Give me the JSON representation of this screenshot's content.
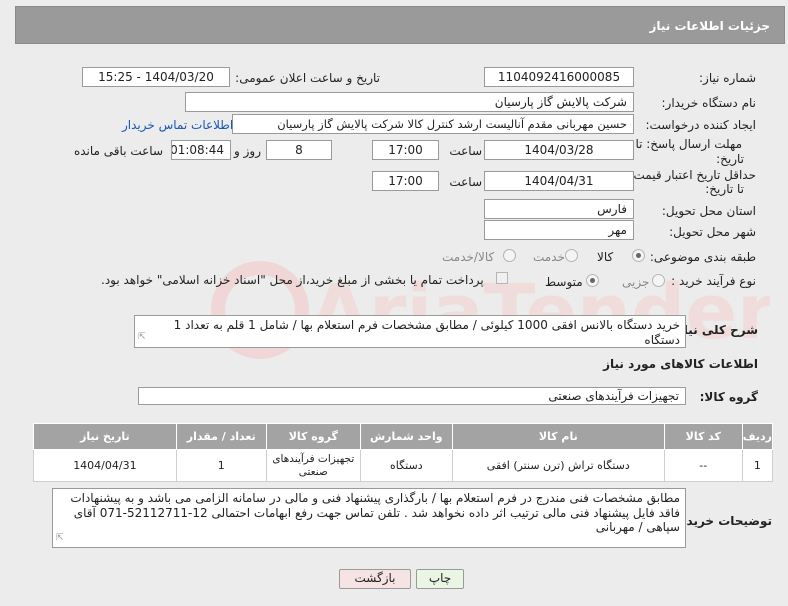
{
  "header": {
    "title": "جزئیات اطلاعات نیاز"
  },
  "fields": {
    "need_number_label": "شماره نیاز:",
    "need_number": "1104092416000085",
    "announce_label": "تاریخ و ساعت اعلان عمومی:",
    "announce_value": "1404/03/20 - 15:25",
    "buyer_org_label": "نام دستگاه خریدار:",
    "buyer_org": "شرکت پالایش گاز پارسیان",
    "requester_label": "ایجاد کننده درخواست:",
    "requester": "حسین مهربانی مقدم آنالیست ارشد کنترل کالا  شرکت پالایش گاز پارسیان",
    "contact_link": "اطلاعات تماس خریدار",
    "reply_deadline_label_1": "مهلت ارسال پاسخ: تا",
    "reply_deadline_label_2": "تاریخ:",
    "reply_date": "1404/03/28",
    "time_label": "ساعت",
    "reply_time": "17:00",
    "days_value": "8",
    "days_label": "روز و",
    "remaining_time": "01:08:44",
    "remaining_label": "ساعت باقی مانده",
    "validity_label_1": "حداقل تاریخ اعتبار قیمت:",
    "validity_label_2": "تا تاریخ:",
    "validity_date": "1404/04/31",
    "validity_time_label": "ساعت",
    "validity_time": "17:00",
    "province_label": "استان محل تحویل:",
    "province": "فارس",
    "city_label": "شهر محل تحویل:",
    "city": "مهر",
    "category_label": "طبقه بندی موضوعی:",
    "category_options": [
      "کالا",
      "خدمت",
      "کالا/خدمت"
    ],
    "category_selected": "کالا",
    "process_label": "نوع فرآیند خرید :",
    "process_options": [
      "جزیی",
      "متوسط"
    ],
    "process_selected": "متوسط",
    "payment_note": "پرداخت تمام یا بخشی از مبلغ خرید،از محل \"اسناد خزانه اسلامی\" خواهد بود."
  },
  "description": {
    "label": "شرح کلی نیاز:",
    "text": "خرید دستگاه بالانس افقی 1000 کیلوئی / مطابق مشخصات فرم استعلام بها / شامل 1 قلم به تعداد 1 دستگاه"
  },
  "goods": {
    "section_title": "اطلاعات کالاهای مورد نیاز",
    "group_label": "گروه کالا:",
    "group_value": "تجهیزات فرآیندهای صنعتی",
    "columns": [
      "ردیف",
      "کد کالا",
      "نام کالا",
      "واحد شمارش",
      "گروه کالا",
      "تعداد / مقدار",
      "تاریخ نیاز"
    ],
    "rows": [
      {
        "index": "1",
        "code": "--",
        "name": "دستگاه تراش (ترن سنتر) افقی",
        "unit": "دستگاه",
        "group": "تجهیزات فرآیندهای صنعتی",
        "qty": "1",
        "date": "1404/04/31"
      }
    ]
  },
  "buyer_notes": {
    "label": "توضیحات خریدار:",
    "text": "مطابق مشخصات فنی مندرج در فرم استعلام بها / بارگذاری پیشنهاد فنی و مالی در سامانه الزامی می باشد و به پیشنهادات فاقد فایل پیشنهاد فنی مالی ترتیب اثر داده نخواهد شد . تلفن تماس جهت رفع ابهامات احتمالی 12-52112711-071 آقای سپاهی / مهربانی"
  },
  "buttons": {
    "print": "چاپ",
    "back": "بازگشت"
  },
  "watermark": {
    "text": "AriaTender.neT"
  },
  "colors": {
    "header_bg": "#9a9a9a",
    "table_header_bg": "#a3a3a3",
    "link": "#1a57b7",
    "back_button_bg": "#f6e3e3",
    "print_button_bg": "#eaf5e4"
  }
}
